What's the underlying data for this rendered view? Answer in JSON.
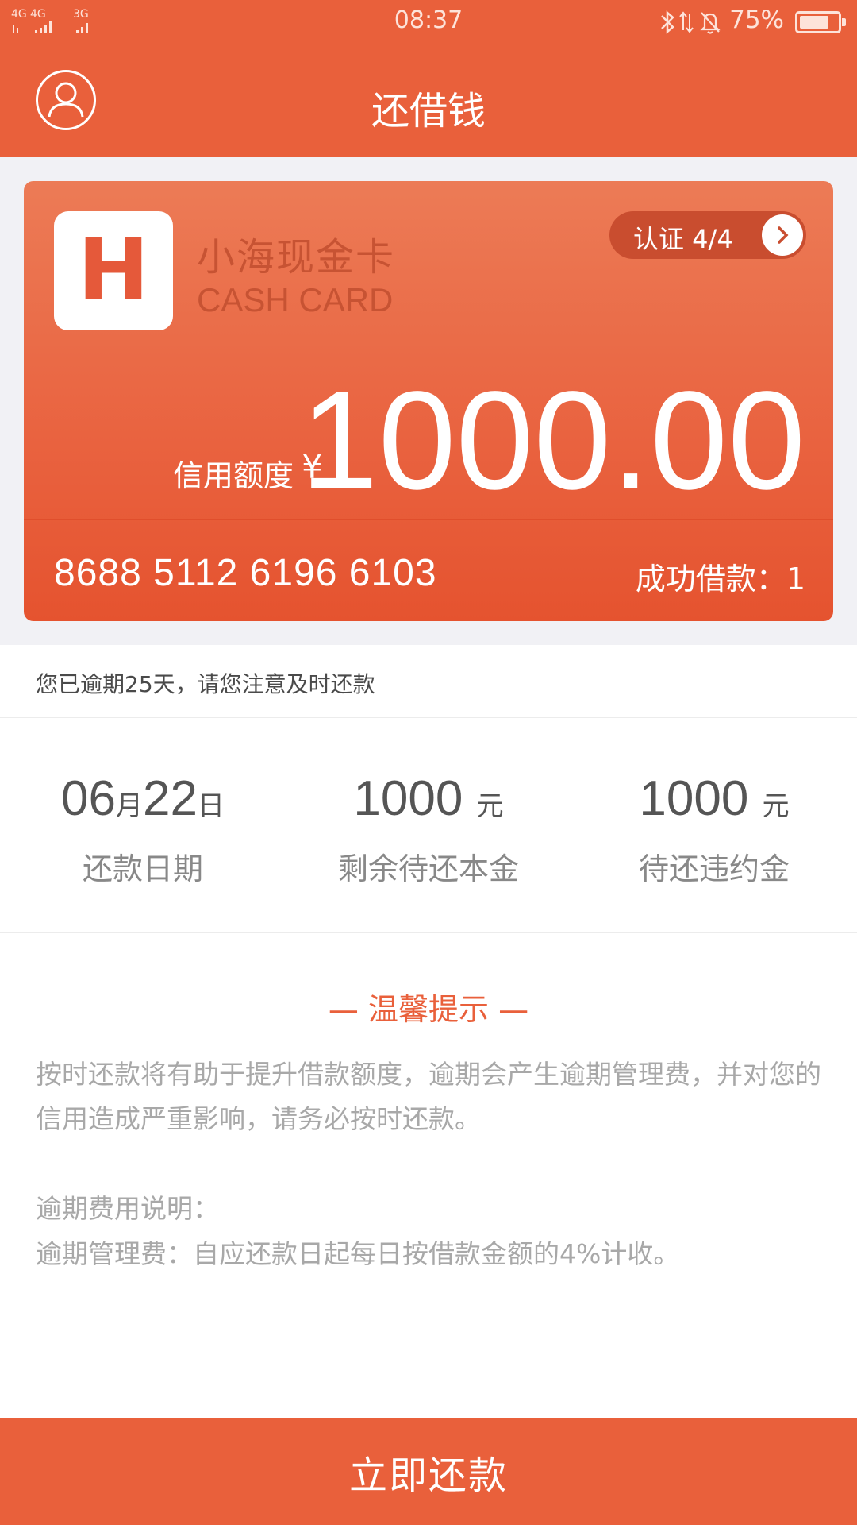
{
  "status_bar": {
    "signal1_label": "4G",
    "signal2_label": "4G",
    "signal3_label": "3G",
    "time": "08:37",
    "battery": "75%"
  },
  "header": {
    "title": "还借钱"
  },
  "card": {
    "logo_letter": "H",
    "brand_cn": "小海现金卡",
    "brand_en": "CASH CARD",
    "verify_label": "认证 4/4",
    "credit_label": "信用额度",
    "currency": "¥",
    "credit_amount": "1000.00",
    "card_number": "8688 5112 6196 6103",
    "loan_count": "成功借款：1"
  },
  "notice": "您已逾期25天，请您注意及时还款",
  "stats": {
    "date": {
      "month": "06",
      "month_unit": "月",
      "day": "22",
      "day_unit": "日",
      "label": "还款日期"
    },
    "principal": {
      "value": "1000",
      "unit": "元",
      "label": "剩余待还本金"
    },
    "penalty": {
      "value": "1000",
      "unit": "元",
      "label": "待还违约金"
    }
  },
  "tips": {
    "title": "— 温馨提示 —",
    "body": "按时还款将有助于提升借款额度，逾期会产生逾期管理费，并对您的信用造成严重影响，请务必按时还款。",
    "fee_title": "逾期费用说明：",
    "fee_desc": "逾期管理费：自应还款日起每日按借款金额的4%计收。"
  },
  "button": {
    "pay_label": "立即还款"
  },
  "colors": {
    "accent": "#e9603b",
    "card_top": "#ec7b56",
    "card_bottom": "#e5532f",
    "badge": "#c94d2f"
  },
  "icons": {
    "avatar": "user-icon",
    "verify_arrow": "chevron-right-icon",
    "bluetooth": "bluetooth-icon",
    "data": "data-arrows-icon",
    "mute": "bell-mute-icon",
    "battery": "battery-icon"
  }
}
